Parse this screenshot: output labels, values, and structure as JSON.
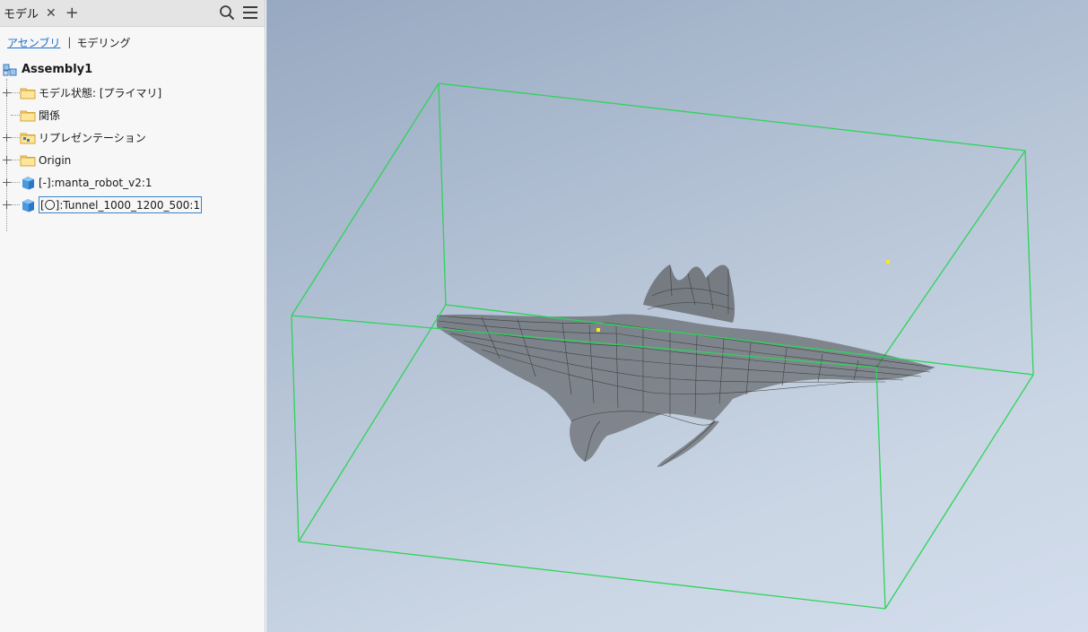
{
  "panel": {
    "tab_label": "モデル",
    "subtabs": {
      "assembly": "アセンブリ",
      "separator": "|",
      "modeling": "モデリング"
    }
  },
  "tree": {
    "root": "Assembly1",
    "items": [
      {
        "label": "モデル状態: [プライマリ]",
        "icon": "folder-icon"
      },
      {
        "label": "関係",
        "icon": "folder-icon"
      },
      {
        "label": "リプレゼンテーション",
        "icon": "representations-folder-icon"
      },
      {
        "label": "Origin",
        "icon": "folder-icon"
      },
      {
        "label": "[-]:manta_robot_v2:1",
        "icon": "part-cube-icon"
      },
      {
        "label": "[〇]:Tunnel_1000_1200_500:1",
        "icon": "part-cube-icon",
        "selected": true
      }
    ]
  },
  "viewport": {
    "background_top": "#97a9c1",
    "background_bottom": "#d3dded",
    "bbox_color": "#2ed35a",
    "wire_color": "#3a3a3a",
    "point_color": "#ffee00"
  }
}
